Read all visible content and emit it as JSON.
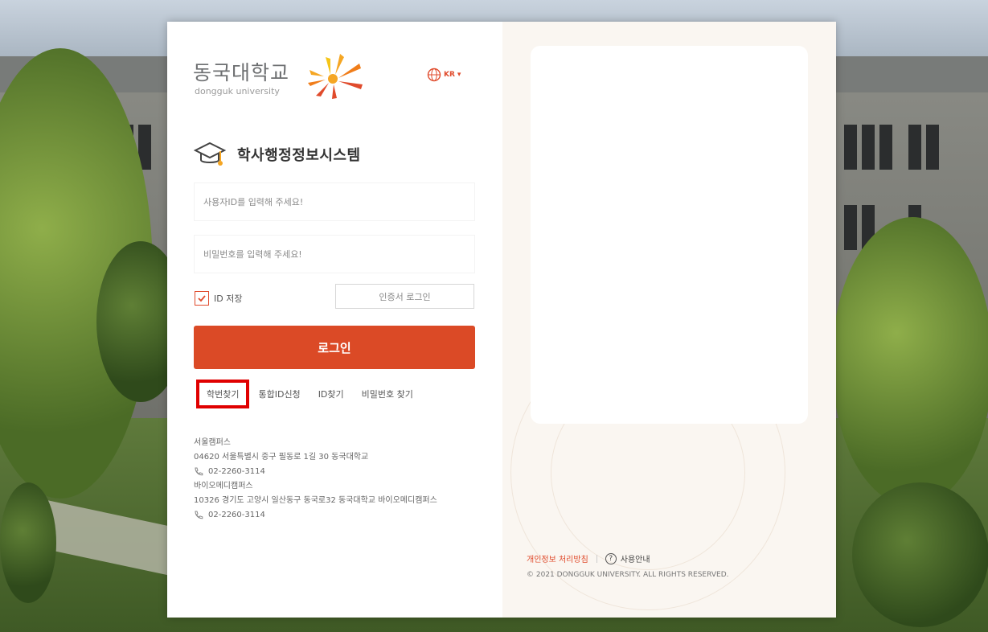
{
  "logo": {
    "name": "동국대학교",
    "sub": "dongguk university"
  },
  "lang": {
    "label": "KR"
  },
  "system_title": "학사행정정보시스템",
  "login": {
    "id_placeholder": "사용자ID를 입력해 주세요!",
    "pw_placeholder": "비밀번호를 입력해 주세요!",
    "remember_label": "ID 저장",
    "remember_checked": true,
    "cert_login_label": "인증서 로그인",
    "login_button": "로그인"
  },
  "links": [
    "학번찾기",
    "통합ID신청",
    "ID찾기",
    "비밀번호 찾기"
  ],
  "campus": {
    "seoul_name": "서울캠퍼스",
    "seoul_address": "04620 서울특별시 중구 필동로 1길 30 동국대학교",
    "seoul_phone": "02-2260-3114",
    "bio_name": "바이오메디캠퍼스",
    "bio_address": "10326 경기도 고양시 일산동구 동국로32 동국대학교 바이오메디캠퍼스",
    "bio_phone": "02-2260-3114"
  },
  "footer": {
    "privacy": "개인정보 처리방침",
    "guide": "사용안내",
    "copyright": "© 2021 DONGGUK UNIVERSITY. ALL RIGHTS RESERVED."
  },
  "colors": {
    "accent": "#db4a26",
    "highlight": "#e00000"
  }
}
